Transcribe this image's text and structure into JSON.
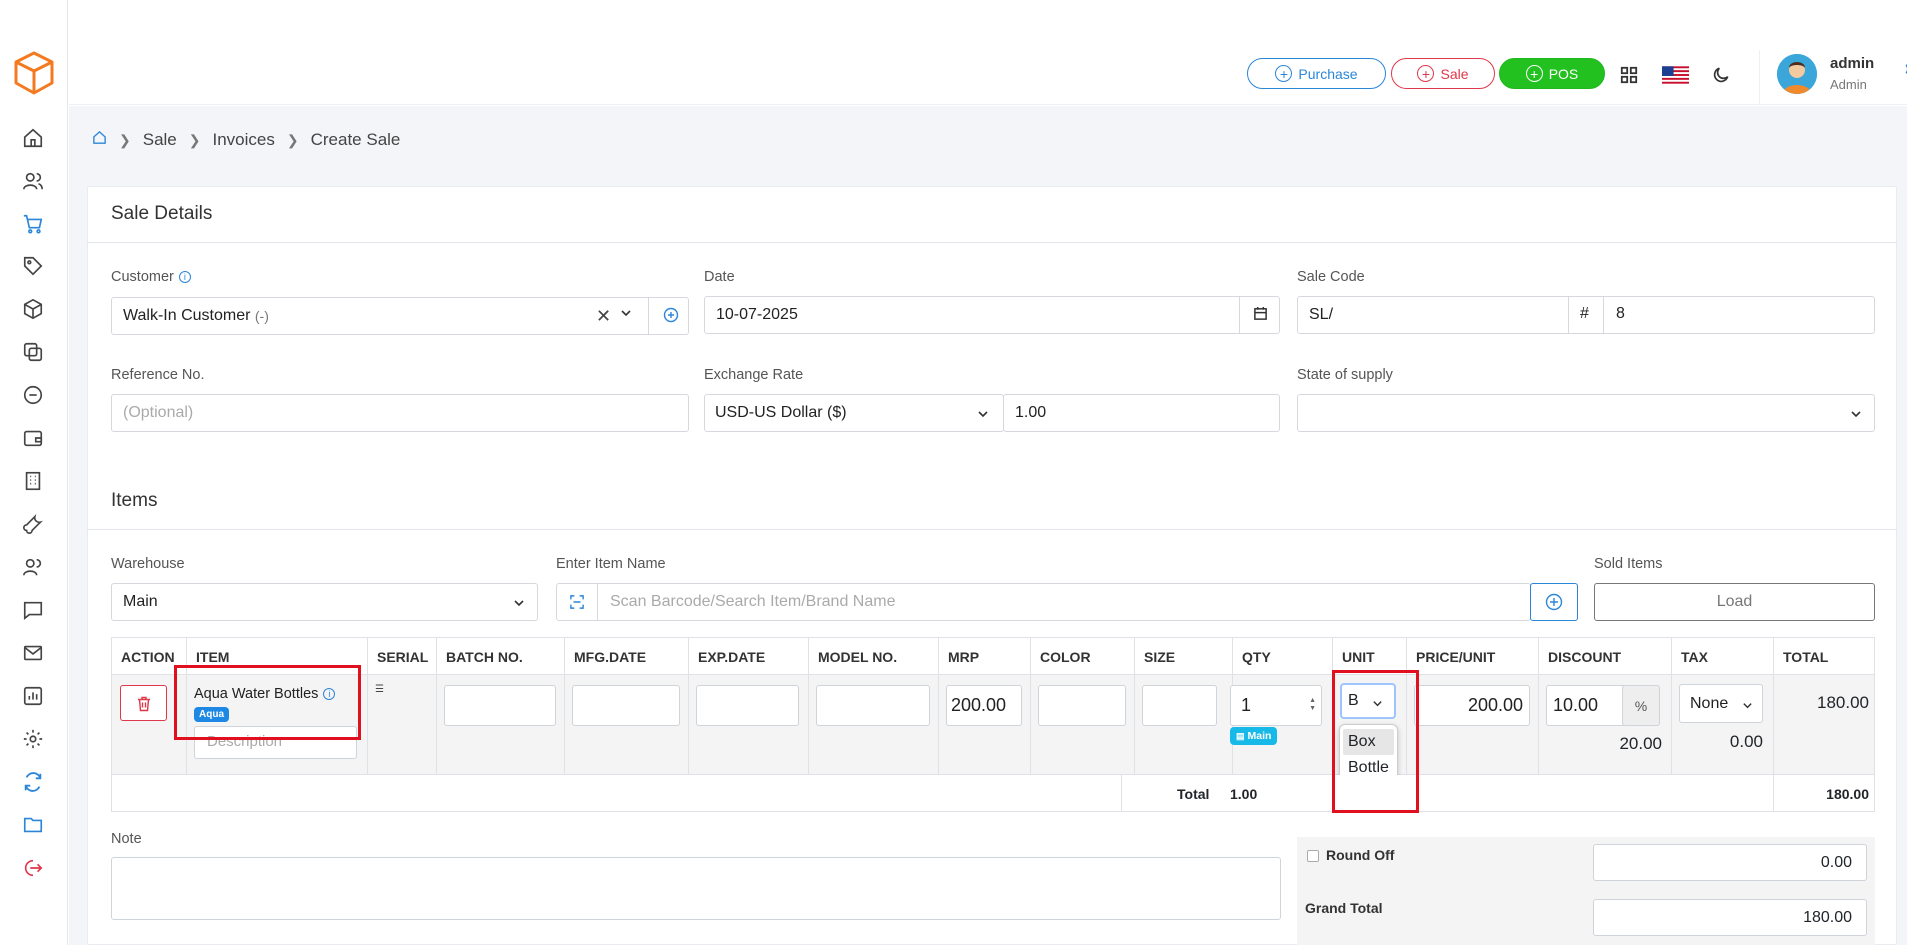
{
  "header": {
    "purchase_label": "Purchase",
    "sale_label": "Sale",
    "pos_label": "POS",
    "user_name": "admin",
    "user_role": "Admin"
  },
  "breadcrumb": [
    "Sale",
    "Invoices",
    "Create Sale"
  ],
  "sale_details": {
    "title": "Sale Details",
    "customer_label": "Customer",
    "customer_value": "Walk-In Customer",
    "customer_suffix": "(-)",
    "date_label": "Date",
    "date_value": "10-07-2025",
    "sale_code_label": "Sale Code",
    "sale_code_prefix": "SL/",
    "sale_code_hash": "#",
    "sale_code_number": "8",
    "reference_label": "Reference No.",
    "reference_placeholder": "(Optional)",
    "exchange_label": "Exchange Rate",
    "currency_value": "USD-US Dollar ($)",
    "exchange_value": "1.00",
    "state_label": "State of supply",
    "state_value": ""
  },
  "items": {
    "title": "Items",
    "warehouse_label": "Warehouse",
    "warehouse_value": "Main",
    "item_name_label": "Enter Item Name",
    "item_search_placeholder": "Scan Barcode/Search Item/Brand Name",
    "sold_items_label": "Sold Items",
    "load_label": "Load",
    "columns": [
      "ACTION",
      "ITEM",
      "SERIAL",
      "BATCH NO.",
      "MFG.DATE",
      "EXP.DATE",
      "MODEL NO.",
      "MRP",
      "COLOR",
      "SIZE",
      "QTY",
      "UNIT",
      "PRICE/UNIT",
      "DISCOUNT",
      "TAX",
      "TOTAL"
    ],
    "row": {
      "item_name": "Aqua Water Bottles",
      "brand_badge": "Aqua",
      "description_placeholder": "Description",
      "mrp": "200.00",
      "qty": "1",
      "warehouse_badge": "Main",
      "unit_value": "B",
      "unit_options": [
        "Box",
        "Bottle"
      ],
      "price": "200.00",
      "discount": "10.00",
      "discount_type": "%",
      "discount_amount": "20.00",
      "tax_value": "None",
      "tax_amount": "0.00",
      "total": "180.00"
    },
    "total_label": "Total",
    "total_qty": "1.00",
    "total_amount": "180.00"
  },
  "footer": {
    "note_label": "Note",
    "round_off_label": "Round Off",
    "round_off_value": "0.00",
    "grand_total_label": "Grand Total",
    "grand_total_value": "180.00"
  },
  "colors": {
    "primary": "#2b86d8",
    "danger": "#e0384b",
    "success": "#22c11f",
    "highlight": "#e0101e"
  }
}
